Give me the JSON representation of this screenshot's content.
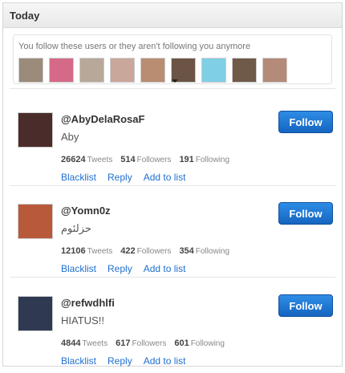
{
  "header": {
    "title": "Today"
  },
  "notice": {
    "text": "You follow these users or they aren't following you anymore",
    "thumbs": [
      {
        "color": "#9a8b7a"
      },
      {
        "color": "#d56a88"
      },
      {
        "color": "#b7a89a"
      },
      {
        "color": "#c9a79a"
      },
      {
        "color": "#b98d72"
      },
      {
        "color": "#6b5446"
      },
      {
        "color": "#7fd0e6"
      },
      {
        "color": "#6f5a4a"
      },
      {
        "color": "#b48a78"
      }
    ]
  },
  "users": [
    {
      "handle": "@AbyDelaRosaF",
      "bio": "Aby",
      "avatar_color": "#4a2c2a",
      "tweets": "26624",
      "tweets_label": "Tweets",
      "followers": "514",
      "followers_label": "Followers",
      "following": "191",
      "following_label": "Following",
      "follow_label": "Follow",
      "blacklist": "Blacklist",
      "reply": "Reply",
      "add_to_list": "Add to list"
    },
    {
      "handle": "@Yomn0z",
      "bio": "حزلئوم",
      "avatar_color": "#b85a3a",
      "tweets": "12106",
      "tweets_label": "Tweets",
      "followers": "422",
      "followers_label": "Followers",
      "following": "354",
      "following_label": "Following",
      "follow_label": "Follow",
      "blacklist": "Blacklist",
      "reply": "Reply",
      "add_to_list": "Add to list"
    },
    {
      "handle": "@refwdhlfi",
      "bio": "HIATUS!!",
      "avatar_color": "#2f3a52",
      "tweets": "4844",
      "tweets_label": "Tweets",
      "followers": "617",
      "followers_label": "Followers",
      "following": "601",
      "following_label": "Following",
      "follow_label": "Follow",
      "blacklist": "Blacklist",
      "reply": "Reply",
      "add_to_list": "Add to list"
    }
  ]
}
